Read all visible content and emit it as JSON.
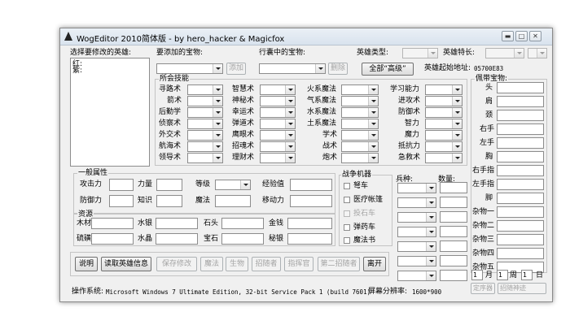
{
  "window": {
    "title": "WogEditor 2010简体版 - by  hero_hacker  &  Magicfox",
    "minimize": "▬",
    "maximize": "□",
    "close": "✕"
  },
  "top": {
    "hero_select_label": "选择要修改的英雄:",
    "hero_list_items": [
      "红:",
      "紫:"
    ],
    "add_treasure_label": "要添加的宝物:",
    "add_button": "添加",
    "bag_treasure_label": "行囊中的宝物:",
    "delete_button": "删除",
    "all_button": "全部“高级”",
    "hero_type_label": "英雄类型:",
    "hero_specialty_label": "英雄特长:",
    "hero_address_label": "英雄起始地址:",
    "hero_address_value": "05700E83"
  },
  "skills": {
    "group_title": "所会技能",
    "columns": [
      [
        "寻路术",
        "箭术",
        "后勤学",
        "侦察术",
        "外交术",
        "航海术",
        "领导术"
      ],
      [
        "智慧术",
        "神秘术",
        "幸运术",
        "弹道术",
        "鹰眼术",
        "招魂术",
        "理财术"
      ],
      [
        "火系魔法",
        "气系魔法",
        "水系魔法",
        "土系魔法",
        "学术",
        "战术",
        "炮术"
      ],
      [
        "学习能力",
        "进攻术",
        "防御术",
        "智力",
        "魔力",
        "抵抗力",
        "急救术"
      ]
    ]
  },
  "treasure": {
    "group_title": "佩带宝物:",
    "slots": [
      "头",
      "肩",
      "颈",
      "右手",
      "左手",
      "胸",
      "右手指",
      "左手指",
      "脚",
      "杂物一",
      "杂物二",
      "杂物三",
      "杂物四",
      "杂物五"
    ]
  },
  "attrs": {
    "group_title": "一般属性",
    "attack": "攻击力",
    "strength": "力量",
    "level": "等级",
    "exp": "经验值",
    "defense": "防御力",
    "knowledge": "知识",
    "magic": "魔法",
    "movement": "移动力"
  },
  "resources": {
    "group_title": "资源",
    "wood": "木材",
    "mercury": "水银",
    "ore": "石头",
    "gold": "金钱",
    "sulfur": "硫磺",
    "crystal": "水晶",
    "gems": "宝石",
    "mithril": "秘银"
  },
  "machines": {
    "group_title": "战争机器",
    "items": [
      "弩车",
      "医疗帐篷",
      "投石车",
      "弹药车",
      "魔法书"
    ]
  },
  "army": {
    "troop_label": "兵种:",
    "count_label": "数量:"
  },
  "buttons": {
    "help": "说明",
    "read_hero": "读取英雄信息",
    "save": "保存修改",
    "magic": "魔法",
    "creature": "生物",
    "hire": "招随者",
    "guide": "指挥官",
    "second_hire": "第二招随者",
    "leave": "离开"
  },
  "date": {
    "month_value": "1",
    "month_label": "月",
    "week_value": "1",
    "week_label": "周",
    "day_value": "1",
    "day_label": "日",
    "timer_button": "定序器",
    "follow_button": "招随神迹"
  },
  "status": {
    "os_label": "操作系统:",
    "os_value": "Microsoft Windows 7 Ultimate Edition, 32-bit Service Pack 1 (build 7601)",
    "resolution_label": "屏幕分辨率:",
    "resolution_value": "1600*900"
  }
}
